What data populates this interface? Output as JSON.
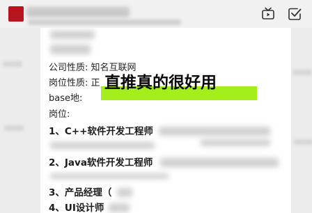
{
  "header": {
    "avatar_color": "#b8141e",
    "icons": [
      "tv-icon",
      "check-square-icon"
    ]
  },
  "post": {
    "fields": [
      {
        "label": "公司性质:",
        "value": "知名互联网"
      },
      {
        "label": "岗位性质:",
        "value": "正"
      },
      {
        "label": "base地:",
        "value": ""
      }
    ],
    "positions_label": "岗位:",
    "jobs": [
      "1、C++软件开发工程师",
      "2、Java软件开发工程师",
      "3、产品经理（",
      "4、UI设计师"
    ]
  },
  "overlay": {
    "text": "直推真的很好用",
    "highlight_color": "#a4ee1b"
  }
}
